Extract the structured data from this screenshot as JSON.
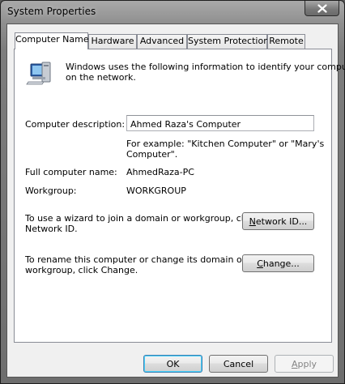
{
  "window": {
    "title": "System Properties"
  },
  "tabs": [
    {
      "label": "Computer Name",
      "active": true
    },
    {
      "label": "Hardware",
      "active": false
    },
    {
      "label": "Advanced",
      "active": false
    },
    {
      "label": "System Protection",
      "active": false
    },
    {
      "label": "Remote",
      "active": false
    }
  ],
  "panel": {
    "intro_line1": "Windows uses the following information to identify your computer",
    "intro_line2": "on the network.",
    "description_label": "Computer description:",
    "description_value": "Ahmed Raza's Computer",
    "example_line1": "For example: \"Kitchen Computer\" or \"Mary's",
    "example_line2": "Computer\".",
    "full_name_label": "Full computer name:",
    "full_name_value": "AhmedRaza-PC",
    "workgroup_label": "Workgroup:",
    "workgroup_value": "WORKGROUP",
    "wizard_line1": "To use a wizard to join a domain or workgroup, click",
    "wizard_line2": "Network ID.",
    "network_id_button": {
      "prefix": "",
      "mnemonic": "N",
      "rest": "etwork ID..."
    },
    "rename_line1": "To rename this computer or change its domain or",
    "rename_line2": "workgroup, click Change.",
    "change_button": {
      "prefix": "",
      "mnemonic": "C",
      "rest": "hange..."
    }
  },
  "footer": {
    "ok_label": "OK",
    "cancel_label": "Cancel",
    "apply_button": {
      "prefix": "",
      "mnemonic": "A",
      "rest": "pply"
    }
  },
  "icons": {
    "close": "close-icon",
    "computer": "computer-icon"
  }
}
